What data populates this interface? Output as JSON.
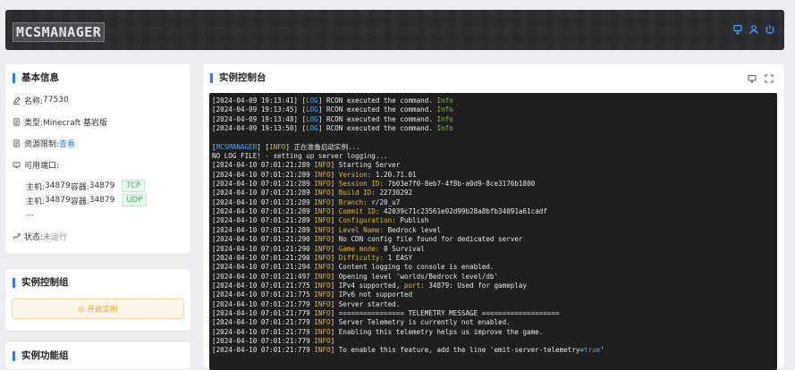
{
  "header": {
    "logo_text": "MCSMANAGER",
    "icons": [
      "server-icon",
      "user-icon",
      "power-icon"
    ]
  },
  "info": {
    "title": "基本信息",
    "name_label": "名称: ",
    "name_value": "77530",
    "type_label": "类型: ",
    "type_value": "Minecraft 基岩版",
    "resource_label": "资源限制: ",
    "resource_link": "查看",
    "ports_label": "可用端口:",
    "ports": [
      {
        "host_label": "主机: ",
        "host": "34879",
        "container_label": " 容器: ",
        "container": "34879",
        "protocol": "TCP"
      },
      {
        "host_label": "主机: ",
        "host": "34879",
        "container_label": " 容器: ",
        "container": "34879",
        "protocol": "UDP"
      }
    ],
    "ports_more": "...",
    "status_label": "状态: ",
    "status_value": "未运行"
  },
  "control": {
    "title": "实例控制组",
    "start_button": "开启实例"
  },
  "functions": {
    "title": "实例功能组"
  },
  "console": {
    "title": "实例控制台",
    "colors": {
      "green": "#7fc04b",
      "blue": "#4aa3ff",
      "yellow": "#e0b43c",
      "background": "#1e1e1e"
    }
  },
  "terminal_lines": [
    {
      "ts": "[2024-04-09 19:13:41]",
      "tag": "LOG",
      "msg": " RCON executed the command. ",
      "suffix": "Info"
    },
    {
      "ts": "[2024-04-09 19:13:45]",
      "tag": "LOG",
      "msg": " RCON executed the command. ",
      "suffix": "Info"
    },
    {
      "ts": "[2024-04-09 19:13:48]",
      "tag": "LOG",
      "msg": " RCON executed the command. ",
      "suffix": "Info"
    },
    {
      "ts": "[2024-04-09 19:13:50]",
      "tag": "LOG",
      "msg": " RCON executed the command. ",
      "suffix": "Info"
    },
    {
      "blank": true
    },
    {
      "pre": "[",
      "tag": "MCSMANAGER",
      "mid": "] [",
      "tag2": "INFO",
      "msg": "] 正在准备启动实例..."
    },
    {
      "plain": "NO LOG FILE! - setting up server logging..."
    },
    {
      "ts": "[2024-04-10 07:01:21:289 ",
      "tag": "INFO",
      "msg": "] Starting Server"
    },
    {
      "ts": "[2024-04-10 07:01:21:289 ",
      "tag": "INFO",
      "msg": "] ",
      "key": "Version: ",
      "val": "1.20.71.01"
    },
    {
      "ts": "[2024-04-10 07:01:21:289 ",
      "tag": "INFO",
      "msg": "] ",
      "key": "Session ID: ",
      "val": "7b03e7f0-8eb7-4f8b-a0d9-8ce3176b1800"
    },
    {
      "ts": "[2024-04-10 07:01:21:289 ",
      "tag": "INFO",
      "msg": "] ",
      "key": "Build ID: ",
      "val": "22730292"
    },
    {
      "ts": "[2024-04-10 07:01:21:289 ",
      "tag": "INFO",
      "msg": "] ",
      "key": "Branch: ",
      "val": "r/20_u7"
    },
    {
      "ts": "[2024-04-10 07:01:21:289 ",
      "tag": "INFO",
      "msg": "] ",
      "key": "Commit ID: ",
      "val": "42039c71c23561e02d99b28a8bfb34091a61cadf"
    },
    {
      "ts": "[2024-04-10 07:01:21:289 ",
      "tag": "INFO",
      "msg": "] ",
      "key": "Configuration: ",
      "val": "Publish"
    },
    {
      "ts": "[2024-04-10 07:01:21:289 ",
      "tag": "INFO",
      "msg": "] ",
      "key": "Level Name: ",
      "val": "Bedrock level"
    },
    {
      "ts": "[2024-04-10 07:01:21:290 ",
      "tag": "INFO",
      "msg": "] No CDN config file found for dedicated server"
    },
    {
      "ts": "[2024-04-10 07:01:21:290 ",
      "tag": "INFO",
      "msg": "] ",
      "key": "Game mode: ",
      "val": "0 Survival"
    },
    {
      "ts": "[2024-04-10 07:01:21:290 ",
      "tag": "INFO",
      "msg": "] ",
      "key": "Difficulty: ",
      "val": "1 EASY"
    },
    {
      "ts": "[2024-04-10 07:01:21:294 ",
      "tag": "INFO",
      "msg": "] Content logging to console is enabled."
    },
    {
      "ts": "[2024-04-10 07:01:21:497 ",
      "tag": "INFO",
      "msg": "] Opening level 'worlds/Bedrock level/db'"
    },
    {
      "ts": "[2024-04-10 07:01:21:775 ",
      "tag": "INFO",
      "msg": "] IPv4 supported, ",
      "key": "port: ",
      "val": "34879",
      "tail": ": Used for gameplay"
    },
    {
      "ts": "[2024-04-10 07:01:21:775 ",
      "tag": "INFO",
      "msg": "] IPv6 not supported"
    },
    {
      "ts": "[2024-04-10 07:01:21:779 ",
      "tag": "INFO",
      "msg": "] Server started."
    },
    {
      "ts": "[2024-04-10 07:01:21:779 ",
      "tag": "INFO",
      "msg": "] ================ TELEMETRY MESSAGE ==================="
    },
    {
      "ts": "[2024-04-10 07:01:21:779 ",
      "tag": "INFO",
      "msg": "] Server Telemetry is currently not enabled."
    },
    {
      "ts": "[2024-04-10 07:01:21:779 ",
      "tag": "INFO",
      "msg": "] Enabling this telemetry helps us improve the game."
    },
    {
      "ts": "[2024-04-10 07:01:21:779 ",
      "tag": "INFO",
      "msg": "]"
    },
    {
      "ts": "[2024-04-10 07:01:21:779 ",
      "tag": "INFO",
      "msg": "] To enable this feature, add the line 'emit-server-telemetry=",
      "val2": "true",
      "tail": "'"
    }
  ]
}
